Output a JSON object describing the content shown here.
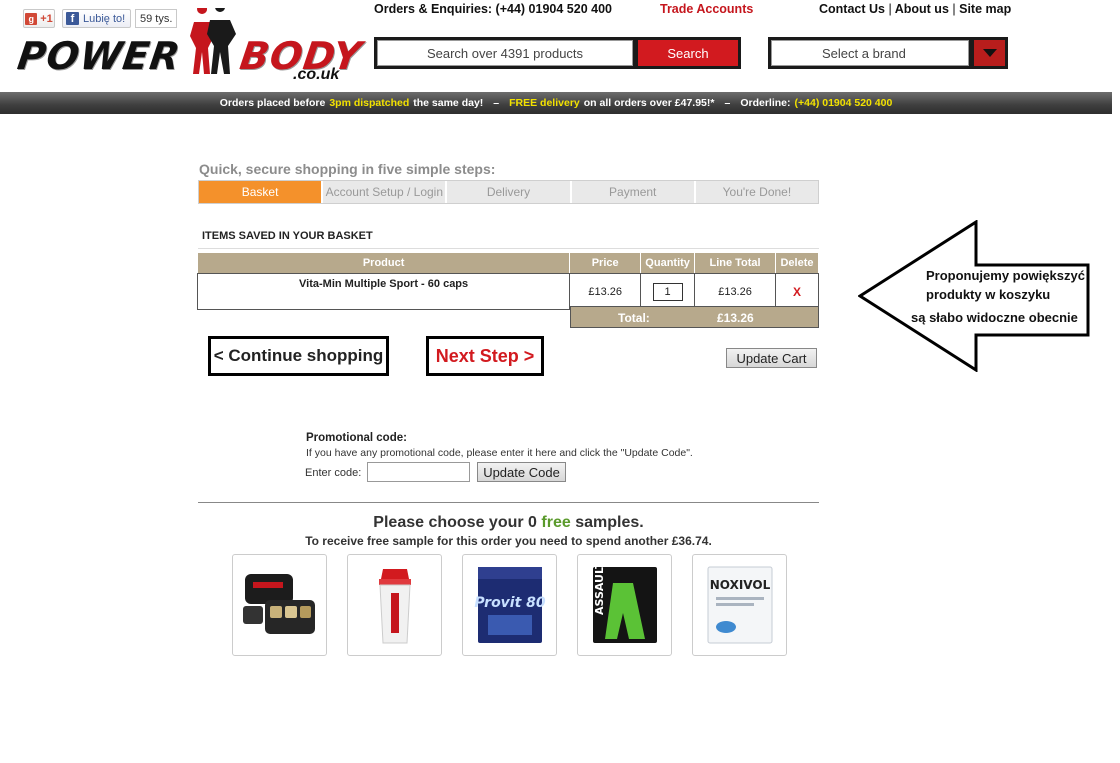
{
  "social": {
    "gplus_label": "+1",
    "fb_like_label": "Lubię to!",
    "fb_count": "59 tys."
  },
  "logo": {
    "word_left": "POWER",
    "word_right": "BODY",
    "suffix": ".co.uk"
  },
  "top_links": {
    "orders": "Orders & Enquiries: (+44) 01904 520 400",
    "trade": "Trade Accounts",
    "contact": "Contact Us",
    "sep1": "|",
    "about": "About us",
    "sep2": "|",
    "sitemap": "Site map"
  },
  "search": {
    "placeholder": "Search over 4391 products",
    "button": "Search"
  },
  "brand_select": {
    "selected": "Select a brand"
  },
  "infobar": {
    "p1": "Orders placed before",
    "p2": "3pm dispatched",
    "p3": "the same day!",
    "sep1": "–",
    "p4": "FREE delivery",
    "p5": "on all orders over £47.95!*",
    "sep2": "–",
    "p6": "Orderline:",
    "p7": "(+44) 01904 520 400"
  },
  "checkout": {
    "title": "Quick, secure shopping in five simple steps:",
    "steps": [
      "Basket",
      "Account Setup / Login",
      "Delivery",
      "Payment",
      "You're Done!"
    ],
    "active_step": 0
  },
  "basket": {
    "title": "ITEMS SAVED IN YOUR BASKET",
    "columns": [
      "Product",
      "Price",
      "Quantity",
      "Line Total",
      "Delete"
    ],
    "rows": [
      {
        "product": "Vita-Min Multiple Sport - 60 caps",
        "price": "£13.26",
        "quantity": "1",
        "line_total": "£13.26",
        "delete": "X"
      }
    ],
    "total_label": "Total:",
    "total_value": "£13.26"
  },
  "actions": {
    "continue": "< Continue shopping",
    "next": "Next Step >",
    "update_cart": "Update Cart"
  },
  "annotation": {
    "line1": "Proponujemy powiększyć",
    "line2": "produkty w koszyku",
    "line3": "są słabo widoczne obecnie"
  },
  "promo": {
    "title": "Promotional code:",
    "desc": "If you have any promotional code, please enter it here and click the \"Update Code\".",
    "label": "Enter code:",
    "value": "",
    "button": "Update Code"
  },
  "samples": {
    "h1": "Please choose your",
    "h2": "0",
    "h3": "free",
    "h4": "samples.",
    "sub": "To receive free sample for this order you need to spend another £36.74.",
    "items": [
      {
        "icon": "pill-box-icon"
      },
      {
        "icon": "shaker-bottle-icon"
      },
      {
        "icon": "provit-sachet-icon",
        "text": "Provit 80"
      },
      {
        "icon": "assault-sachet-icon",
        "text": "ASSAULT"
      },
      {
        "icon": "noxivol-sachet-icon",
        "text": "NOXIVOL"
      }
    ]
  },
  "colors": {
    "accent_red": "#d21a1f",
    "step_active": "#f4912b",
    "table_header": "#b7a98c",
    "free_green": "#5a9a2b"
  }
}
